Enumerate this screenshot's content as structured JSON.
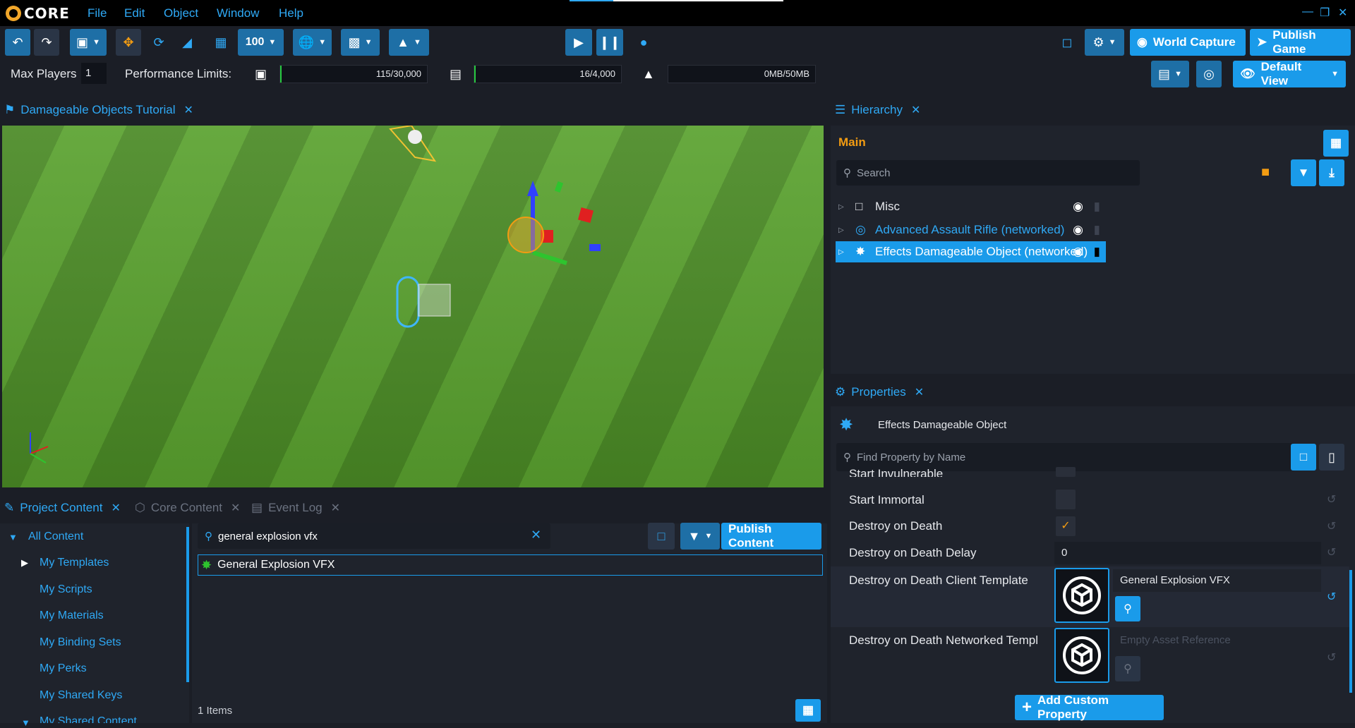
{
  "app": {
    "logo_text": "CORE"
  },
  "menu": {
    "file": "File",
    "edit": "Edit",
    "object": "Object",
    "window": "Window",
    "help": "Help"
  },
  "toolbar": {
    "grid_size": "100",
    "world_capture": "World Capture",
    "publish_game": "Publish Game",
    "default_view": "Default View"
  },
  "limits": {
    "max_players_label": "Max Players",
    "max_players_value": "1",
    "performance_label": "Performance Limits:",
    "objects": "115/30,000",
    "networked": "16/4,000",
    "memory": "0MB/50MB",
    "objects_fraction": 0.0038,
    "networked_fraction": 0.004,
    "memory_fraction": 0.0
  },
  "viewport": {
    "tab_title": "Damageable Objects Tutorial"
  },
  "hierarchy": {
    "tab_title": "Hierarchy",
    "root": "Main",
    "search_placeholder": "Search",
    "items": [
      {
        "label": "Misc",
        "color": "#e6e8ec"
      },
      {
        "label": "Advanced Assault Rifle (networked)",
        "color": "#2fa9f5"
      },
      {
        "label": "Effects Damageable Object (networked)",
        "color": "#ffffff"
      }
    ]
  },
  "properties": {
    "tab_title": "Properties",
    "object_name": "Effects Damageable Object",
    "find_placeholder": "Find Property by Name",
    "rows": {
      "start_invulnerable": "Start Invulnerable",
      "start_immortal": "Start Immortal",
      "destroy_on_death": "Destroy on Death",
      "destroy_on_death_delay": "Destroy on Death Delay",
      "destroy_on_death_delay_value": "0",
      "client_template": "Destroy on Death Client Template",
      "client_template_value": "General Explosion VFX",
      "networked_template": "Destroy on Death Networked Templ",
      "networked_template_placeholder": "Empty Asset Reference"
    },
    "add_custom": "Add Custom Property"
  },
  "bottom_tabs": {
    "project": "Project Content",
    "core": "Core Content",
    "events": "Event Log"
  },
  "project": {
    "tree": [
      "All Content",
      "My Templates",
      "My Scripts",
      "My Materials",
      "My Binding Sets",
      "My Perks",
      "My Shared Keys",
      "My Shared Content"
    ],
    "search_value": "general explosion vfx",
    "publish": "Publish Content",
    "results": [
      "General Explosion VFX"
    ],
    "count": "1 Items"
  },
  "colors": {
    "accent": "#1a9bea",
    "link": "#2fa9f5",
    "orange": "#f39c12"
  }
}
